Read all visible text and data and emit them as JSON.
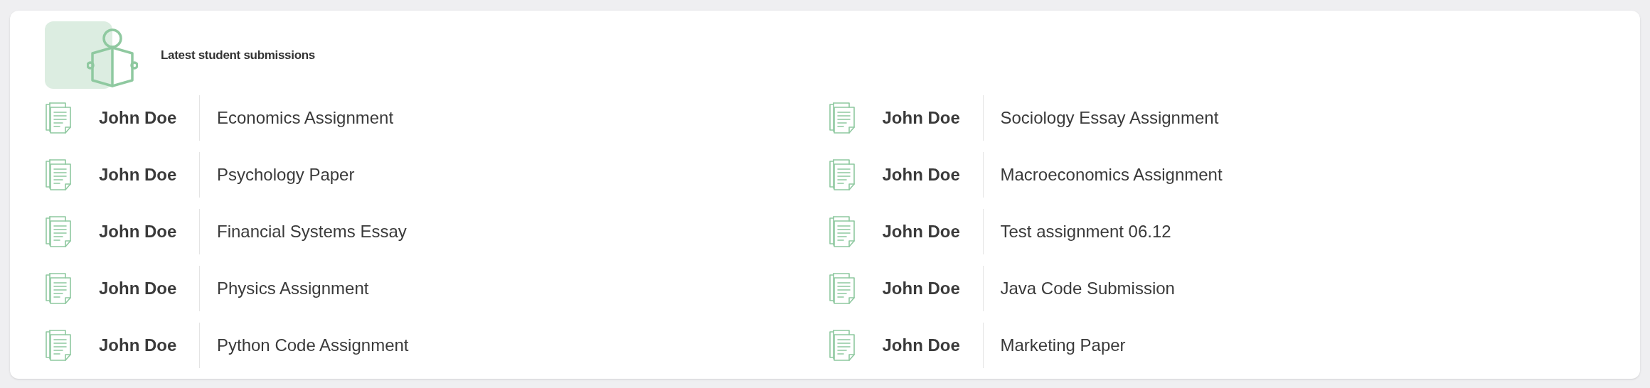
{
  "card": {
    "title": "Latest student submissions"
  },
  "submissions": [
    {
      "student": "John Doe",
      "title": "Economics Assignment"
    },
    {
      "student": "John Doe",
      "title": "Psychology Paper"
    },
    {
      "student": "John Doe",
      "title": "Financial Systems Essay"
    },
    {
      "student": "John Doe",
      "title": "Physics Assignment"
    },
    {
      "student": "John Doe",
      "title": "Python Code Assignment"
    },
    {
      "student": "John Doe",
      "title": "Sociology Essay Assignment"
    },
    {
      "student": "John Doe",
      "title": "Macroeconomics Assignment"
    },
    {
      "student": "John Doe",
      "title": "Test assignment 06.12"
    },
    {
      "student": "John Doe",
      "title": "Java Code Submission"
    },
    {
      "student": "John Doe",
      "title": "Marketing Paper"
    }
  ]
}
